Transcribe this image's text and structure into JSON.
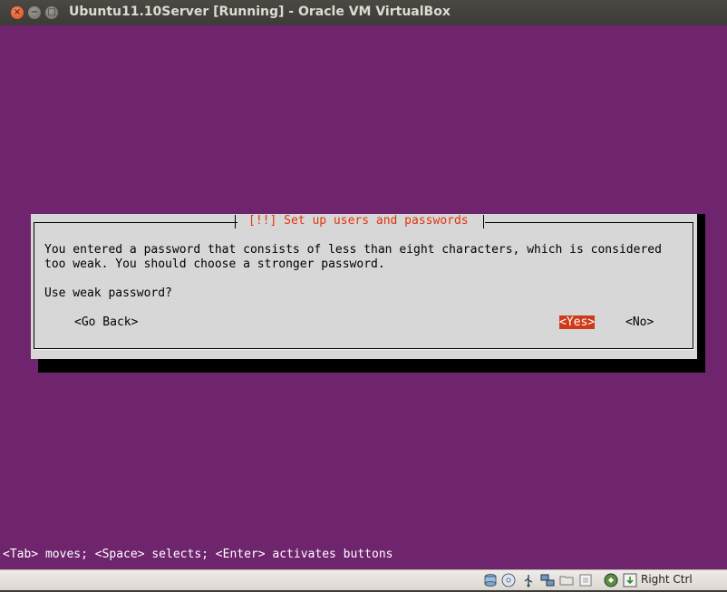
{
  "window": {
    "title": "Ubuntu11.10Server [Running] - Oracle VM VirtualBox",
    "close_glyph": "×",
    "minimize_glyph": "−",
    "maximize_glyph": "□"
  },
  "dialog": {
    "title": "[!!] Set up users and passwords",
    "message_line1": "You entered a password that consists of less than eight characters, which is considered",
    "message_line2": "too weak. You should choose a stronger password.",
    "question": "Use weak password?",
    "go_back_label": "<Go Back>",
    "yes_label": "<Yes>",
    "no_label": "<No>",
    "selected": "yes"
  },
  "footer_hint": "<Tab> moves; <Space> selects; <Enter> activates buttons",
  "statusbar": {
    "icons": [
      "hard-disk-icon",
      "optical-drive-icon",
      "usb-icon",
      "network-icon",
      "shared-folders-icon",
      "video-capture-icon",
      "virtualization-icon",
      "mouse-integration-icon"
    ],
    "host_key_label": "Right Ctrl"
  },
  "colors": {
    "screen_bg": "#6f256d",
    "dialog_bg": "#d7d7d7",
    "dialog_title": "#e0350f",
    "selected_button_bg": "#cf3a1b"
  }
}
